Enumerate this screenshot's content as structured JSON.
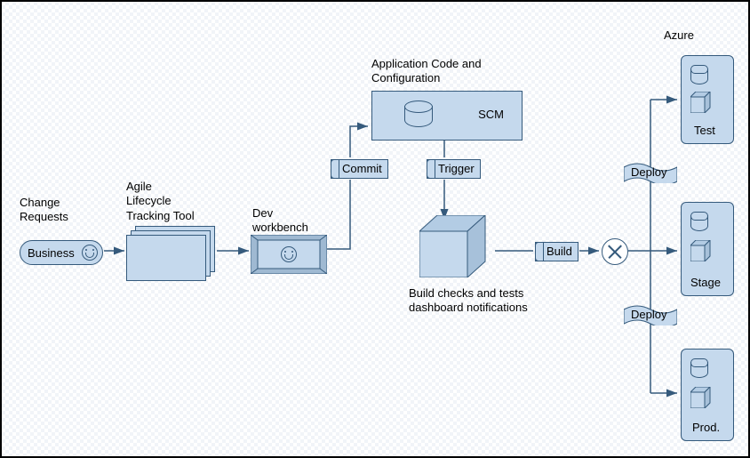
{
  "azure_label": "Azure",
  "change_requests_label": "Change\nRequests",
  "business_label": "Business",
  "agile_tool_label": "Agile\nLifecycle\nTracking Tool",
  "dev_workbench_label": "Dev\nworkbench",
  "commit_label": "Commit",
  "app_code_label": "Application Code and\nConfiguration",
  "scm_label": "SCM",
  "trigger_label": "Trigger",
  "build_label": "Build",
  "build_desc": "Build checks and tests\ndashboard notifications",
  "deploy_label_top": "Deploy",
  "deploy_label_bottom": "Deploy",
  "env": {
    "test": "Test",
    "stage": "Stage",
    "prod": "Prod."
  }
}
